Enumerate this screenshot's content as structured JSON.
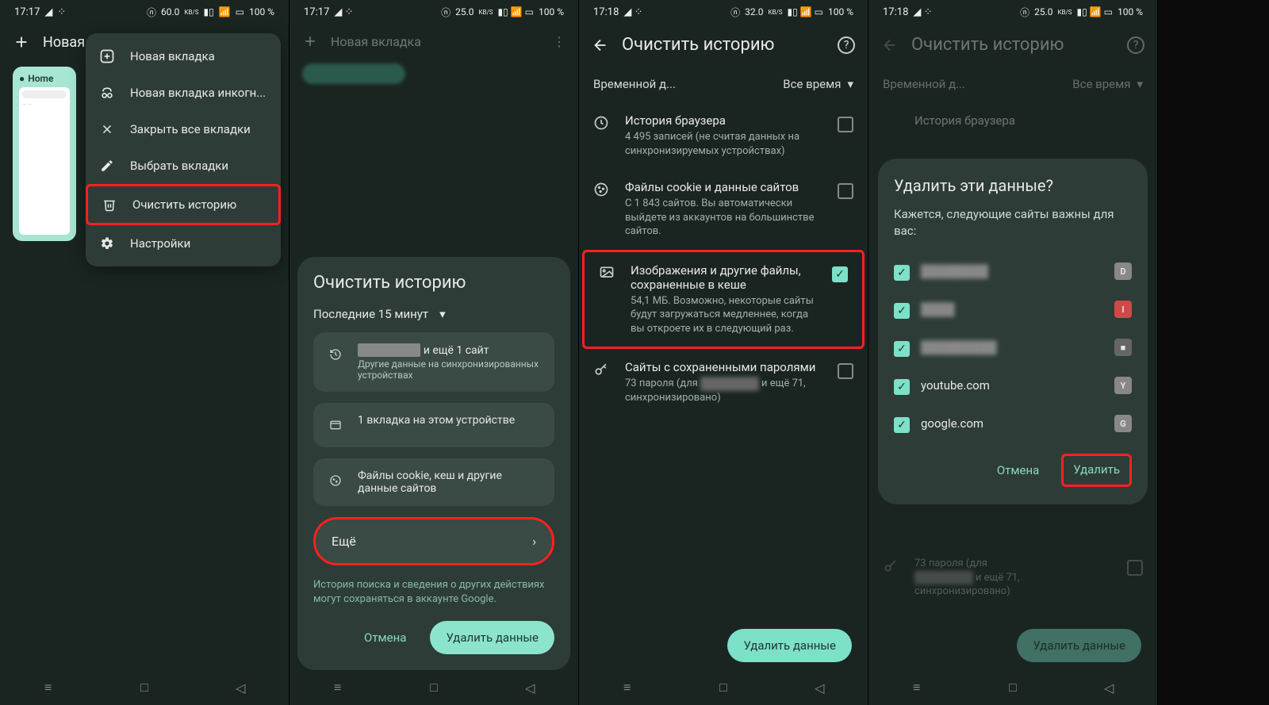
{
  "status": {
    "time_a": "17:17",
    "time_b": "17:17",
    "time_c": "17:18",
    "time_d": "17:18",
    "battery": "100 %",
    "speed_a": "60.0",
    "speed_b": "25.0",
    "speed_c": "32.0",
    "speed_d": "25.0",
    "kbs": "KB/S"
  },
  "screen1": {
    "header_new_tab": "Новая ...",
    "tab_title": "Home",
    "menu": {
      "new_tab": "Новая вкладка",
      "incognito": "Новая вкладка инкогн...",
      "close_all": "Закрыть все вкладки",
      "select": "Выбрать вкладки",
      "clear_history": "Очистить историю",
      "settings": "Настройки"
    }
  },
  "screen2": {
    "header_new_tab": "Новая вкладка",
    "sheet_title": "Очистить историю",
    "time_range": "Последние 15 минут",
    "site_suffix": "и ещё 1 сайт",
    "site_sub": "Другие данные на синхронизированных устройствах",
    "tab_on_device": "1 вкладка на этом устройстве",
    "cookies": "Файлы cookie, кеш и другие данные сайтов",
    "more": "Ещё",
    "info": "История поиска и сведения о других действиях могут сохраняться в аккаунте Google.",
    "cancel": "Отмена",
    "delete": "Удалить данные"
  },
  "screen3": {
    "title": "Очистить историю",
    "time_label": "Временной д...",
    "time_value": "Все время",
    "items": [
      {
        "title": "История браузера",
        "sub": "4 495 записей (не считая данных на синхронизируемых устройствах)",
        "checked": false
      },
      {
        "title": "Файлы cookie и данные сайтов",
        "sub": "С 1 843 сайтов. Вы автоматически выйдете из аккаунтов на большинстве сайтов.",
        "checked": false
      },
      {
        "title": "Изображения и другие файлы, сохраненные в кеше",
        "sub": "54,1 МБ. Возможно, некоторые сайты будут загружаться медленнее, когда вы откроете их в следующий раз.",
        "checked": true
      },
      {
        "title": "Сайты с сохраненными паролями",
        "sub_prefix": "73 пароля (для ",
        "sub_suffix": " и ещё 71, синхронизировано)",
        "checked": false
      }
    ],
    "delete": "Удалить данные"
  },
  "screen4": {
    "title": "Очистить историю",
    "time_label": "Временной д...",
    "time_value": "Все время",
    "history_label": "История браузера",
    "passwords_prefix": "73 пароля (для",
    "passwords_suffix": " и ещё 71, синхронизировано)",
    "dialog": {
      "title": "Удалить эти данные?",
      "subtitle": "Кажется, следующие сайты важны для вас:",
      "sites": [
        {
          "name": "████████",
          "badge": "D",
          "badge_bg": "#888"
        },
        {
          "name": "████",
          "badge": "I",
          "badge_bg": "#d04848"
        },
        {
          "name": "█████████",
          "badge": "■",
          "badge_bg": "#666"
        },
        {
          "name": "youtube.com",
          "badge": "Y",
          "badge_bg": "#888"
        },
        {
          "name": "google.com",
          "badge": "G",
          "badge_bg": "#888"
        }
      ],
      "cancel": "Отмена",
      "delete": "Удалить"
    },
    "delete_bottom": "Удалить данные"
  }
}
